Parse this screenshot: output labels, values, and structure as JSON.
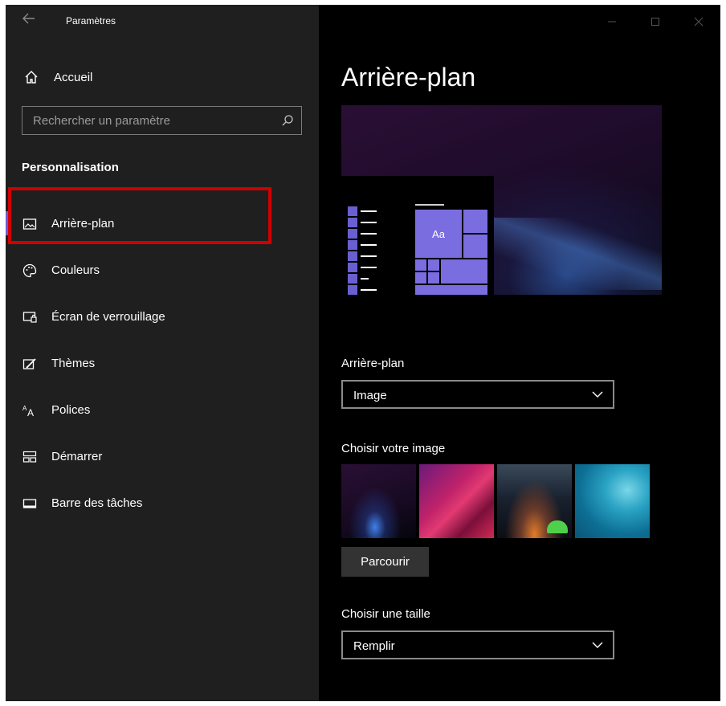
{
  "window": {
    "title": "Paramètres"
  },
  "sidebar": {
    "home_label": "Accueil",
    "search": {
      "placeholder": "Rechercher un paramètre"
    },
    "section_title": "Personnalisation",
    "items": [
      {
        "label": "Arrière-plan",
        "icon": "picture-icon",
        "active": true
      },
      {
        "label": "Couleurs",
        "icon": "palette-icon"
      },
      {
        "label": "Écran de verrouillage",
        "icon": "lock-screen-icon"
      },
      {
        "label": "Thèmes",
        "icon": "themes-icon"
      },
      {
        "label": "Polices",
        "icon": "fonts-icon"
      },
      {
        "label": "Démarrer",
        "icon": "start-icon"
      },
      {
        "label": "Barre des tâches",
        "icon": "taskbar-icon"
      }
    ]
  },
  "main": {
    "title": "Arrière-plan",
    "preview": {
      "tile_text": "Aa"
    },
    "background_label": "Arrière-plan",
    "background_value": "Image",
    "choose_image_label": "Choisir votre image",
    "browse_label": "Parcourir",
    "choose_size_label": "Choisir une taille",
    "size_value": "Remplir"
  },
  "colors": {
    "accent": "#6b5ccf",
    "highlight": "#d10000"
  }
}
